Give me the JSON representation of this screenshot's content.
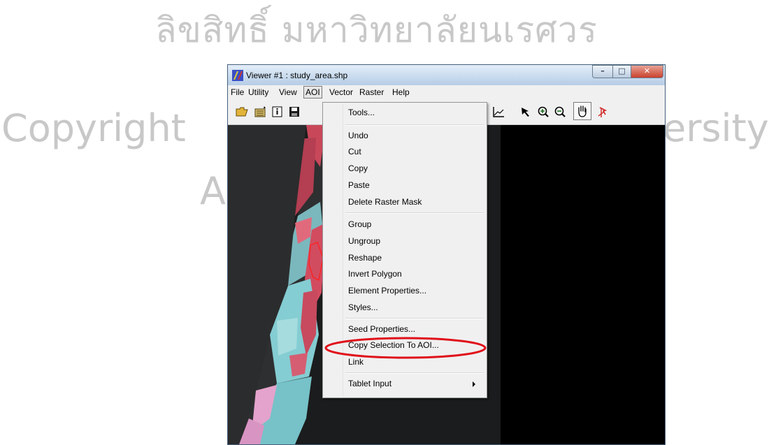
{
  "watermark": {
    "thai_line": "ลิขสิทธิ์ มหาวิทยาลัยนเรศวร",
    "left_fragment": "Copyright",
    "right_fragment": "ersity",
    "au_fragment": "Al"
  },
  "window": {
    "title": "Viewer #1 : study_area.shp",
    "controls": {
      "minimize": "–",
      "maximize": "□",
      "close": "✕"
    }
  },
  "menubar": {
    "items": [
      "File",
      "Utility",
      "View",
      "AOI",
      "Vector",
      "Raster",
      "Help"
    ],
    "active": "AOI"
  },
  "toolbar": {
    "icons": [
      "open-folder-icon",
      "new-layer-icon",
      "info-icon",
      "save-icon",
      "profile-chart-icon",
      "select-arrow-icon",
      "zoom-in-icon",
      "zoom-out-icon",
      "pan-hand-icon",
      "inquire-cursor-icon"
    ]
  },
  "aoi_menu": {
    "items": [
      "Tools...",
      "Undo",
      "Cut",
      "Copy",
      "Paste",
      "Delete Raster Mask",
      "Group",
      "Ungroup",
      "Reshape",
      "Invert Polygon",
      "Element Properties...",
      "Styles...",
      "Seed Properties...",
      "Copy Selection To AOI...",
      "Link",
      "Tablet Input"
    ],
    "highlighted_item": "Copy Selection To AOI...",
    "submenu_item": "Tablet Input"
  },
  "colors": {
    "viewer_background": "#000000",
    "raster_dark": "#2a2b2c",
    "raster_cyan": "#7ecbd0",
    "raster_red": "#d24c60",
    "raster_pink": "#e4a3cc",
    "highlight_ring": "#e0101a"
  }
}
